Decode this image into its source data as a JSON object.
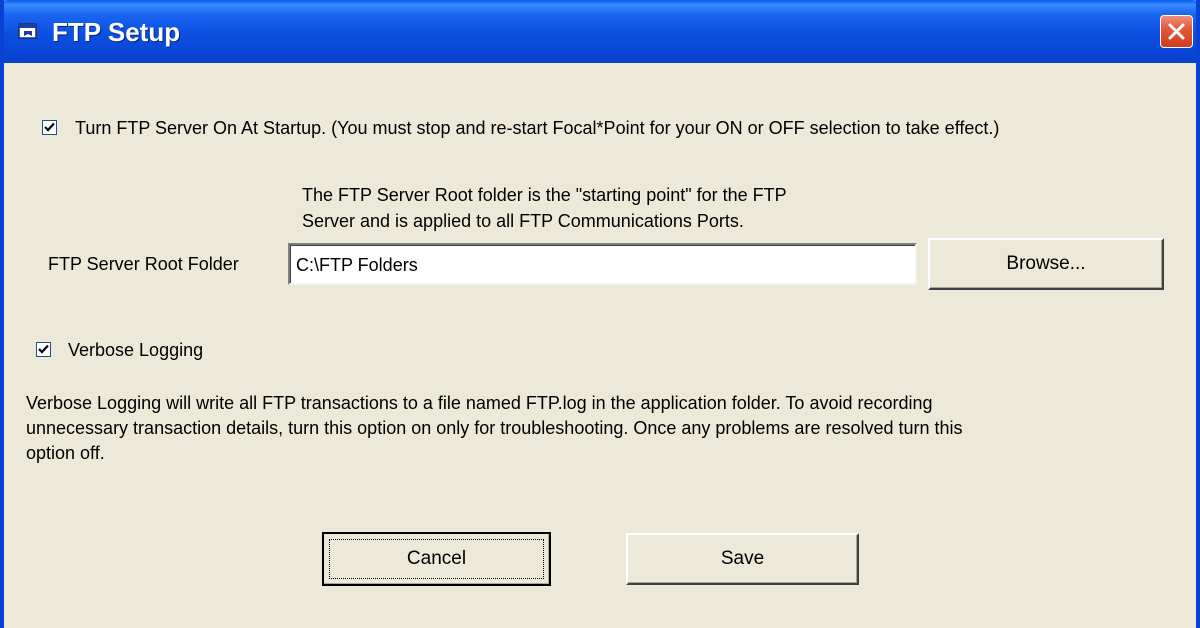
{
  "window": {
    "title": "FTP Setup",
    "icons": {
      "app": "ftp-setup-icon",
      "close": "close-icon"
    },
    "colors": {
      "titlebar": "#0a47d6",
      "close": "#e45a3d",
      "face": "#ece9d8"
    }
  },
  "startup_option": {
    "checked": true,
    "label": "Turn FTP Server On At Startup. (You must stop and re-start Focal*Point for your ON or OFF selection to take effect.)"
  },
  "root_folder": {
    "description_line1": "The FTP Server Root folder is the \"starting point\" for the FTP",
    "description_line2": "Server and is applied to all FTP Communications Ports.",
    "label": "FTP Server Root Folder",
    "value": "C:\\FTP Folders",
    "browse_label": "Browse..."
  },
  "verbose_logging": {
    "checked": true,
    "label": "Verbose Logging",
    "help_line1": "Verbose Logging will write all FTP transactions to a file named FTP.log in the application folder.  To avoid recording",
    "help_line2": "unnecessary transaction details, turn this option on only for troubleshooting.  Once any problems are resolved turn this",
    "help_line3": "option off."
  },
  "actions": {
    "cancel_label": "Cancel",
    "save_label": "Save"
  }
}
